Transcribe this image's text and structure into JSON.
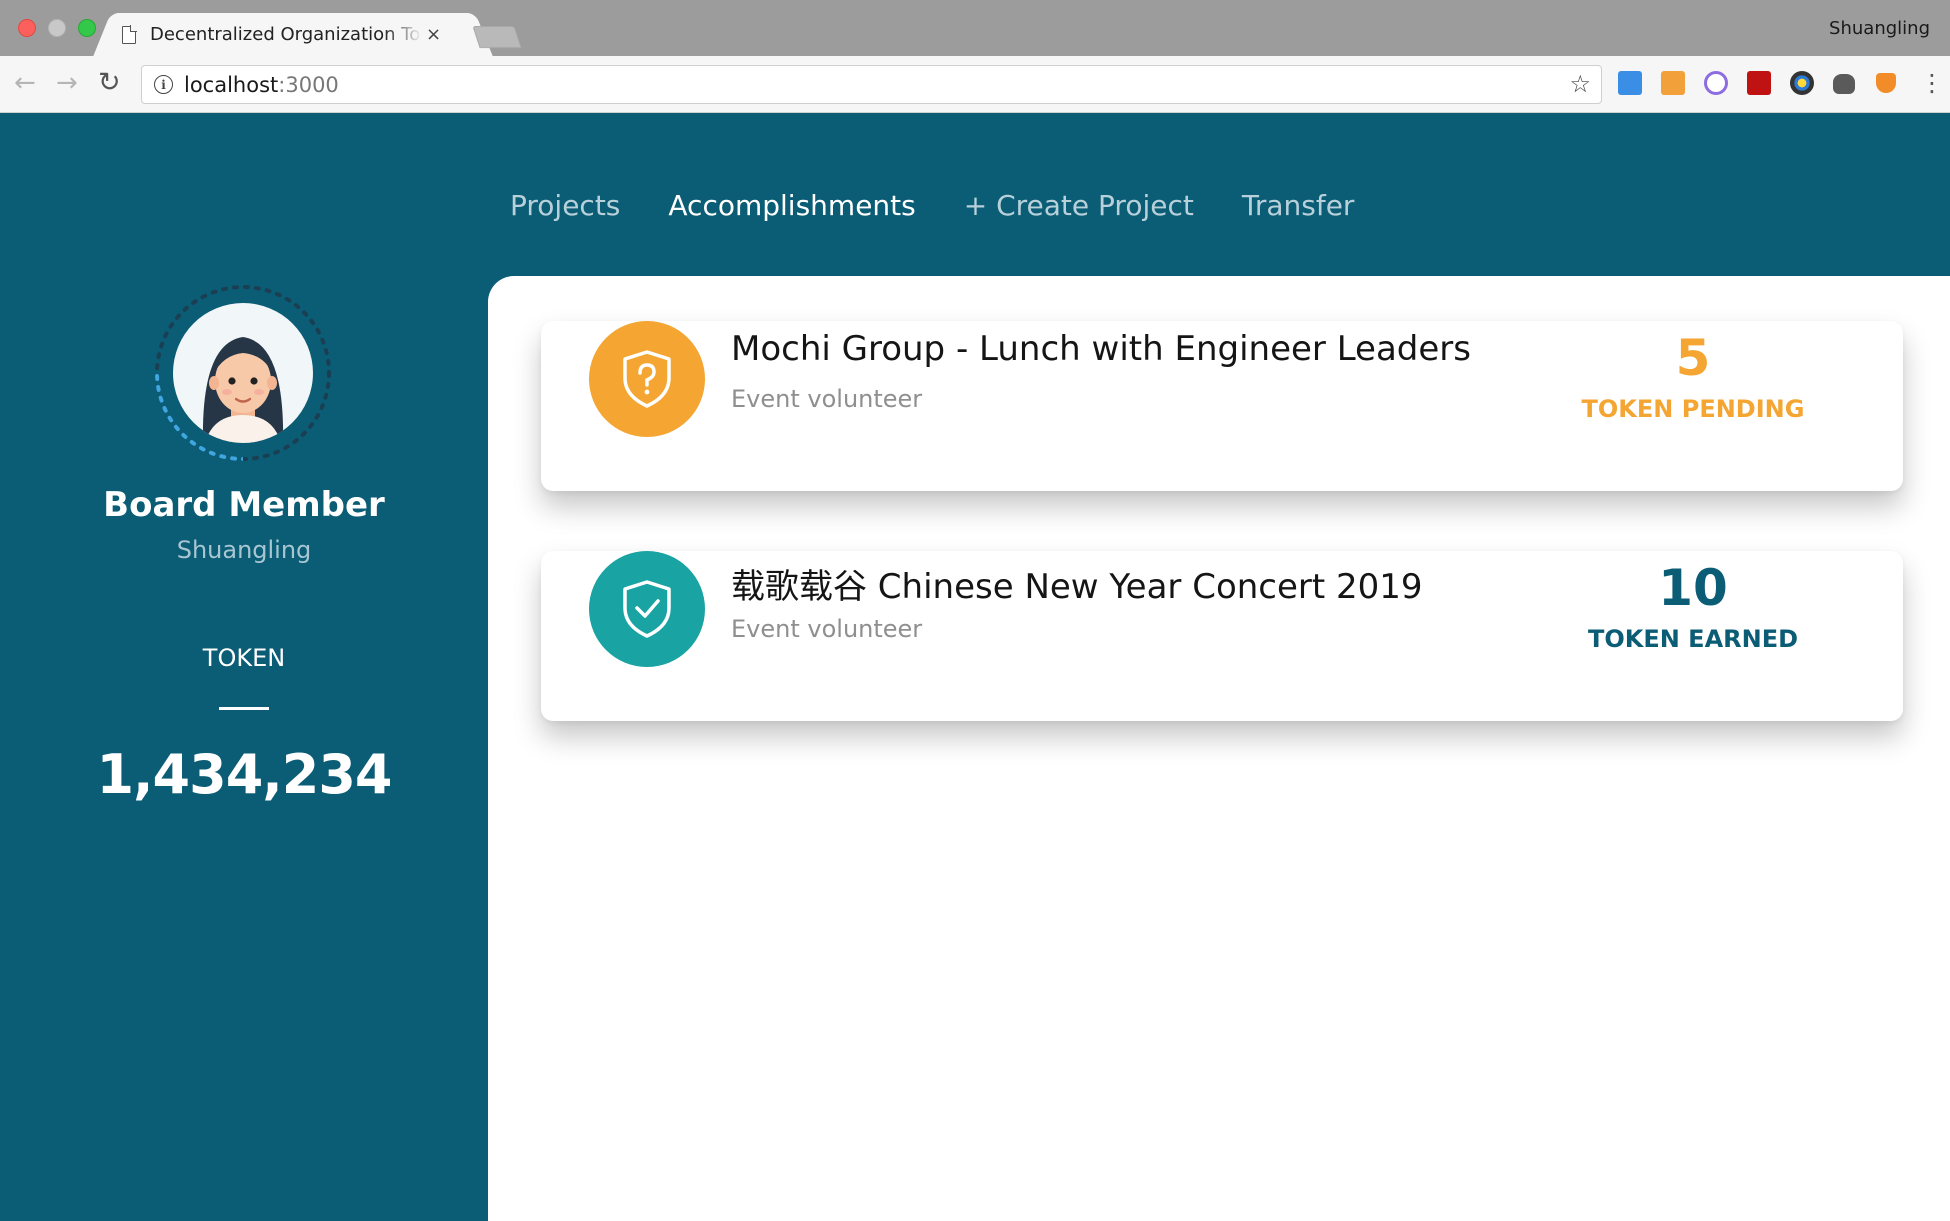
{
  "browser": {
    "tab_title": "Decentralized Organization Tok",
    "tab_close": "×",
    "profile_name": "Shuangling",
    "url_host": "localhost",
    "url_port": ":3000",
    "back_glyph": "←",
    "forward_glyph": "→",
    "reload_glyph": "↻",
    "info_glyph": "i",
    "star_glyph": "☆",
    "menu_glyph": "⋮",
    "extensions": [
      "resize-icon",
      "grid-icon",
      "ring-icon",
      "pdf-icon",
      "color-wheel-icon",
      "camera-icon",
      "fox-icon"
    ]
  },
  "nav": {
    "items": [
      {
        "label": "Projects",
        "active": false
      },
      {
        "label": "Accomplishments",
        "active": true
      },
      {
        "label": "+ Create Project",
        "active": false
      },
      {
        "label": "Transfer",
        "active": false
      }
    ]
  },
  "profile": {
    "role": "Board Member",
    "username": "Shuangling",
    "token_label": "TOKEN",
    "token_amount": "1,434,234"
  },
  "accomplishments": [
    {
      "title": "Mochi Group - Lunch with Engineer Leaders",
      "subtitle": "Event volunteer",
      "token_value": "5",
      "token_status": "TOKEN PENDING",
      "icon": "shield-question-icon",
      "color": "#f4a532"
    },
    {
      "title": "载歌载谷 Chinese New Year Concert 2019",
      "subtitle": "Event volunteer",
      "token_value": "10",
      "token_status": "TOKEN EARNED",
      "icon": "shield-check-icon",
      "color": "#1aa3a3"
    }
  ],
  "colors": {
    "app_bg": "#0b5c75",
    "pending": "#f4a532",
    "earned": "#1aa3a3",
    "earned_text": "#0b5c75"
  }
}
